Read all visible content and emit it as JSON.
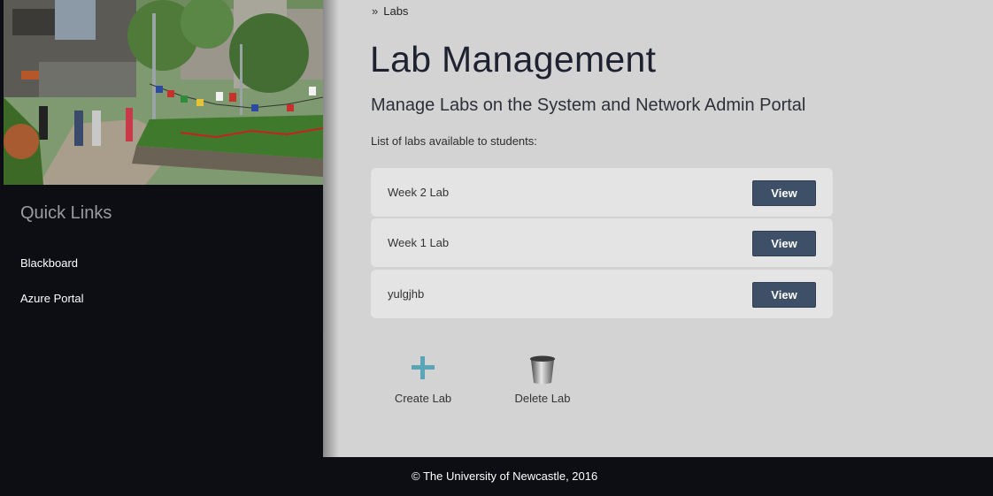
{
  "sidebar": {
    "quick_links_title": "Quick Links",
    "links": [
      "Blackboard",
      "Azure Portal"
    ]
  },
  "breadcrumb": {
    "separator": "»",
    "current": "Labs"
  },
  "main": {
    "title": "Lab Management",
    "subtitle": "Manage Labs on the System and Network Admin Portal",
    "list_intro": "List of labs available to students:",
    "labs": [
      {
        "name": "Week 2 Lab",
        "action": "View"
      },
      {
        "name": "Week 1 Lab",
        "action": "View"
      },
      {
        "name": "yulgjhb",
        "action": "View"
      }
    ],
    "actions": {
      "create": "Create Lab",
      "delete": "Delete Lab"
    }
  },
  "footer": {
    "text": "© The University of Newcastle, 2016"
  },
  "colors": {
    "accent": "#5aa5b8",
    "button": "#3e5068",
    "sidebar": "#0d0e14"
  },
  "icons": {
    "create": "plus-icon",
    "delete": "trash-bin-icon"
  }
}
